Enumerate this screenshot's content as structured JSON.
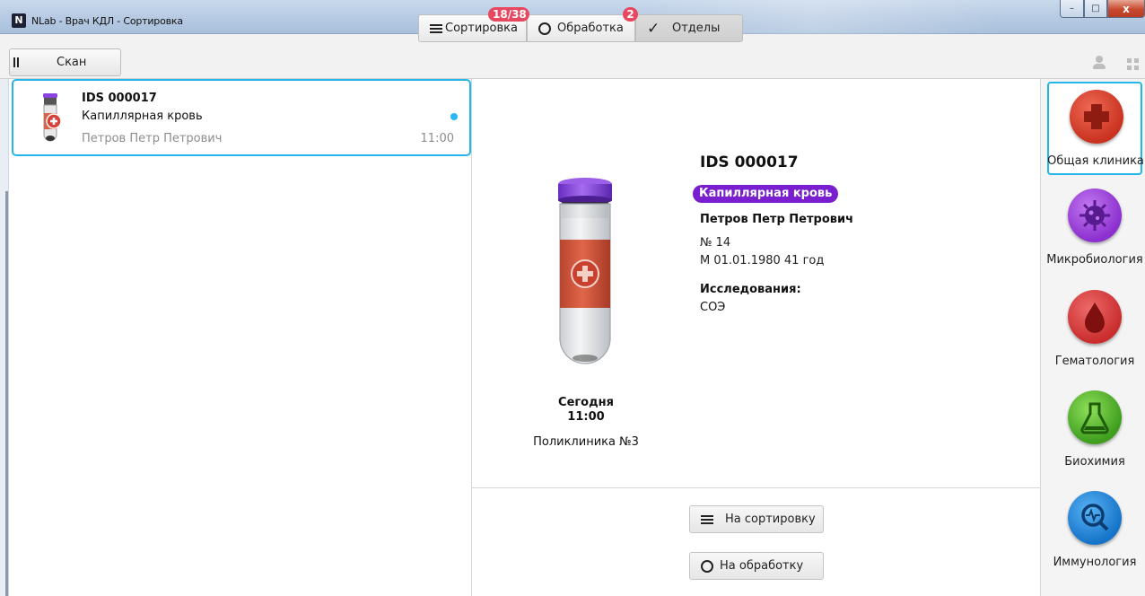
{
  "window": {
    "app_icon_letter": "N",
    "title": "NLab - Врач КДЛ - Сортировка",
    "minimize": "–",
    "maximize": "□",
    "close": "x"
  },
  "toolbar": {
    "scan_label": "Скан",
    "tabs": [
      {
        "label": "Сортировка",
        "badge": "18/38",
        "icon": "menu-icon"
      },
      {
        "label": "Обработка",
        "badge": "2",
        "icon": "circle-icon"
      },
      {
        "label": "Отделы",
        "icon": "check-icon",
        "selected": true
      }
    ],
    "icons": [
      "user-icon",
      "grid-icon"
    ]
  },
  "samples": [
    {
      "id": "IDS 000017",
      "type": "Капиллярная кровь",
      "patient": "Петров Петр Петрович",
      "time": "11:00",
      "unread": true,
      "selected": true
    }
  ],
  "detail": {
    "id": "IDS 000017",
    "type": "Капиллярная кровь",
    "type_color": "#7a1fd0",
    "patient": "Петров Петр Петрович",
    "number": "№ 14",
    "birth": "М 01.01.1980 41 год",
    "research_label": "Исследования:",
    "research": "СОЭ",
    "day": "Сегодня",
    "time": "11:00",
    "place": "Поликлиника №3"
  },
  "actions": {
    "to_sorting": "На сортировку",
    "to_processing": "На обработку"
  },
  "departments": [
    {
      "label": "Общая клиника",
      "icon": "medical-cross-icon",
      "color": "#d43a2c",
      "selected": true
    },
    {
      "label": "Микробиология",
      "icon": "virus-icon",
      "color": "#9a3fd0"
    },
    {
      "label": "Гематология",
      "icon": "blood-drop-icon",
      "color": "#d23a3a"
    },
    {
      "label": "Биохимия",
      "icon": "flask-icon",
      "color": "#4caf2a"
    },
    {
      "label": "Иммунология",
      "icon": "magnifier-pulse-icon",
      "color": "#1e88d8"
    }
  ],
  "colors": {
    "accent": "#25b5e8",
    "badge": "#e74860"
  }
}
